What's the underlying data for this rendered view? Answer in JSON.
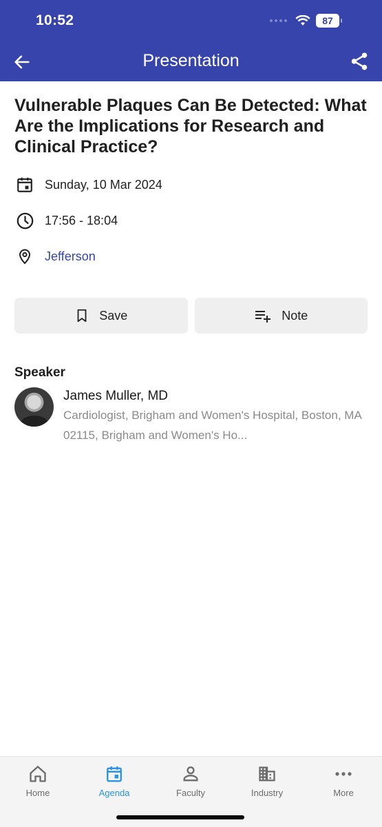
{
  "status_bar": {
    "time": "10:52",
    "battery": "87"
  },
  "header": {
    "title": "Presentation"
  },
  "presentation": {
    "title": "Vulnerable Plaques Can Be Detected: What Are the Implications for Research and Clinical Practice?",
    "date": "Sunday, 10 Mar 2024",
    "time": "17:56 - 18:04",
    "location": "Jefferson"
  },
  "actions": {
    "save_label": "Save",
    "note_label": "Note"
  },
  "speaker_section": {
    "heading": "Speaker",
    "speakers": [
      {
        "name": "James Muller, MD",
        "description": "Cardiologist, Brigham and Women's Hospital, Boston, MA 02115, Brigham and Women's Ho..."
      }
    ]
  },
  "tabbar": {
    "active_color": "#2a94e3",
    "items": [
      {
        "label": "Home",
        "icon": "home-icon"
      },
      {
        "label": "Agenda",
        "icon": "calendar-icon",
        "active": true
      },
      {
        "label": "Faculty",
        "icon": "person-icon"
      },
      {
        "label": "Industry",
        "icon": "building-icon"
      },
      {
        "label": "More",
        "icon": "more-icon"
      }
    ]
  },
  "colors": {
    "brand": "#3644ab",
    "link": "#3846a8"
  }
}
